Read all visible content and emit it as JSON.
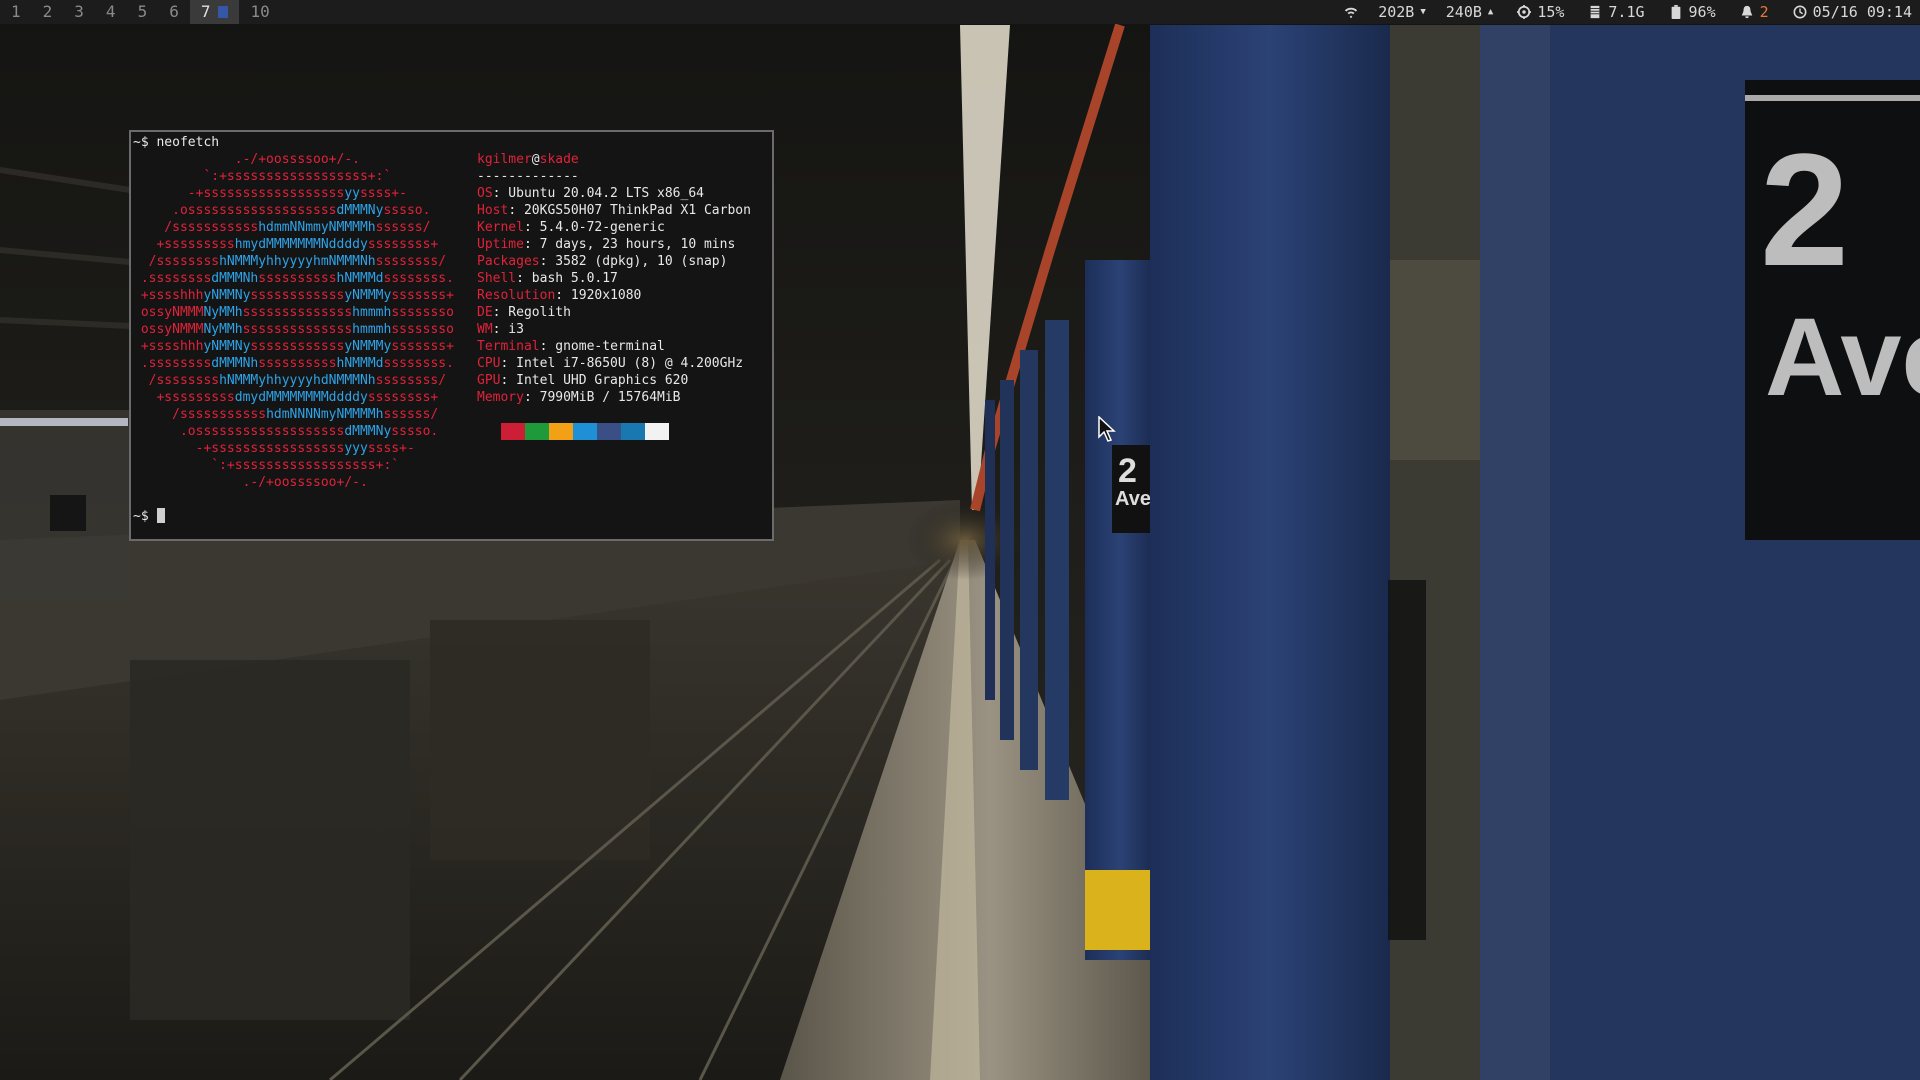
{
  "topbar": {
    "workspaces": [
      {
        "label": "1"
      },
      {
        "label": "2"
      },
      {
        "label": "3"
      },
      {
        "label": "4"
      },
      {
        "label": "5"
      },
      {
        "label": "6"
      },
      {
        "label": "7",
        "active": true
      },
      {
        "label": "10"
      }
    ],
    "status": {
      "wifi_icon": "wifi-icon",
      "net_down": "202B",
      "net_up": "240B",
      "cpu_icon": "cpu-icon",
      "cpu": "15%",
      "mem_icon": "memory-icon",
      "mem": "7.1G",
      "battery_icon": "battery-icon",
      "battery": "96%",
      "bell_icon": "bell-icon",
      "notifications": "2",
      "clock_icon": "clock-icon",
      "datetime": "05/16 09:14"
    }
  },
  "terminal": {
    "prompt": "~$",
    "command": "neofetch",
    "logo": [
      "             .-/+oossssoo+/-.",
      "         `:+ssssssssssssssssss+:`",
      "       -+ssssssssssssssssssyyssss+-",
      "     .osssssssssssssssssssdMMMNysssso.",
      "    /ssssssssssshdmmNNmmyNMMMMhssssss/",
      "   +ssssssssshmydMMMMMMMNddddyssssssss+",
      "  /sssssssshNMMMyhhyyyyhmNMMMNhssssssss/",
      " .ssssssssdMMMNhsssssssssshNMMMdssssssss.",
      " +sssshhhyNMMNyssssssssssssyNMMMysssssss+",
      " ossyNMMMNyMMhsssssssssssssshmmmhssssssso",
      " ossyNMMMNyMMhsssssssssssssshmmmhssssssso",
      " +sssshhhyNMMNyssssssssssssyNMMMysssssss+",
      " .ssssssssdMMMNhsssssssssshNMMMdssssssss.",
      "  /sssssssshNMMMyhhyyyyhdNMMMNhssssssss/",
      "   +sssssssssdmydMMMMMMMMddddyssssssss+",
      "     /ssssssssssshdmNNNNmyNMMMMhssssss/",
      "      .osssssssssssssssssssdMMMNysssso.",
      "        -+sssssssssssssssssyyyssss+-",
      "          `:+ssssssssssssssssss+:`",
      "              .-/+oossssoo+/-."
    ],
    "user": "kgilmer",
    "at": "@",
    "host": "skade",
    "separator": "-------------",
    "info": [
      {
        "label": "OS",
        "value": ": Ubuntu 20.04.2 LTS x86_64"
      },
      {
        "label": "Host",
        "value": ": 20KGS50H07 ThinkPad X1 Carbon"
      },
      {
        "label": "Kernel",
        "value": ": 5.4.0-72-generic"
      },
      {
        "label": "Uptime",
        "value": ": 7 days, 23 hours, 10 mins"
      },
      {
        "label": "Packages",
        "value": ": 3582 (dpkg), 10 (snap)"
      },
      {
        "label": "Shell",
        "value": ": bash 5.0.17"
      },
      {
        "label": "Resolution",
        "value": ": 1920x1080"
      },
      {
        "label": "DE",
        "value": ": Regolith"
      },
      {
        "label": "WM",
        "value": ": i3"
      },
      {
        "label": "Terminal",
        "value": ": gnome-terminal"
      },
      {
        "label": "CPU",
        "value": ": Intel i7-8650U (8) @ 4.200GHz"
      },
      {
        "label": "GPU",
        "value": ": Intel UHD Graphics 620"
      },
      {
        "label": "Memory",
        "value": ": 7990MiB / 15764MiB"
      }
    ],
    "palette": [
      "#cc1f35",
      "#1f9a3a",
      "#f2a116",
      "#1f8fd6",
      "#3a4f86",
      "#1a78b0",
      "#f2f2f2"
    ],
    "prompt2": "~$"
  },
  "wallpaper": {
    "sign_number": "2",
    "sign_text": "Ave"
  }
}
